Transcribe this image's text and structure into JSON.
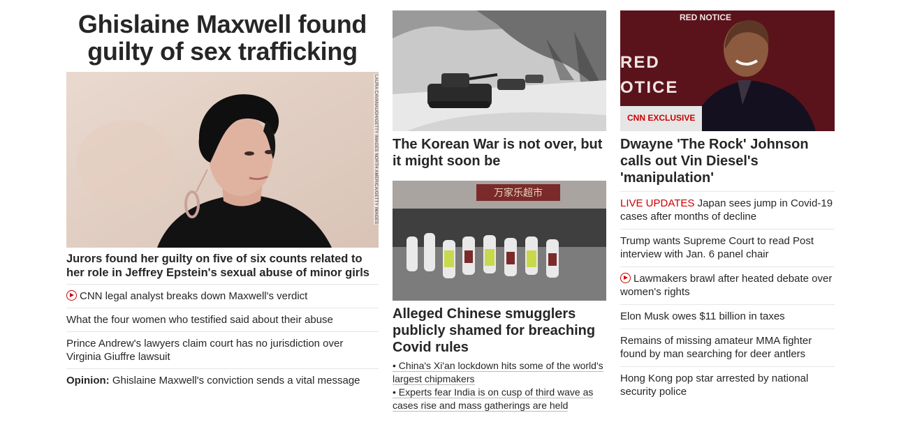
{
  "lead": {
    "headline": "Ghislaine Maxwell found guilty of sex trafficking",
    "image_credit": "LAURA CAVANAUGH/GETTY IMAGES NORTH AMERICA/GETTY IMAGES",
    "subheadline": "Jurors found her guilty on five of six counts related to her role in Jeffrey Epstein's sexual abuse of minor girls",
    "related": [
      {
        "text": "CNN legal analyst breaks down Maxwell's verdict",
        "video": true
      },
      {
        "text": "What the four women who testified said about their abuse"
      },
      {
        "text": "Prince Andrew's lawyers claim court has no jurisdiction over Virginia Giuffre lawsuit"
      },
      {
        "prefix": "Opinion:",
        "text": "Ghislaine Maxwell's conviction sends a vital message"
      }
    ]
  },
  "middle": {
    "story1": {
      "headline": "The Korean War is not over, but it might soon be"
    },
    "story2": {
      "headline": "Alleged Chinese smugglers publicly shamed for breaching Covid rules",
      "sign_text": "万家乐超市",
      "bullets": [
        "• China's Xi'an lockdown hits some of the world's largest chipmakers",
        "• Experts fear India is on cusp of third wave as cases rise and mass gatherings are held"
      ]
    }
  },
  "right": {
    "feature": {
      "badge": "CNN EXCLUSIVE",
      "backdrop_text_top": "RED NOTICE",
      "backdrop_text_1": "RED",
      "backdrop_text_2": "OTICE",
      "headline": "Dwayne 'The Rock' Johnson calls out Vin Diesel's 'manipulation'"
    },
    "stories": [
      {
        "prefix": "LIVE UPDATES",
        "text": "Japan sees jump in Covid-19 cases after months of decline"
      },
      {
        "text": "Trump wants Supreme Court to read Post interview with Jan. 6 panel chair"
      },
      {
        "text": "Lawmakers brawl after heated debate over women's rights",
        "video": true
      },
      {
        "text": "Elon Musk owes $11 billion in taxes"
      },
      {
        "text": "Remains of missing amateur MMA fighter found by man searching for deer antlers"
      },
      {
        "text": "Hong Kong pop star arrested by national security police"
      }
    ]
  },
  "colors": {
    "accent": "#cc0000",
    "text": "#262626",
    "divider": "#e6e6e6"
  }
}
